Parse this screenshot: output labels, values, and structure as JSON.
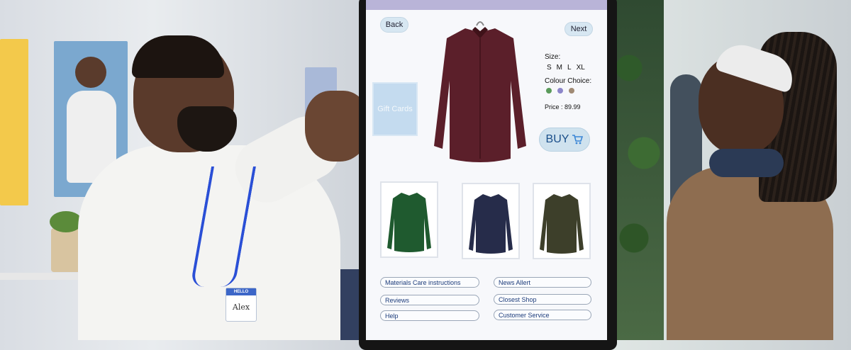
{
  "kiosk": {
    "nav": {
      "back_label": "Back",
      "next_label": "Next"
    },
    "gift_cards_label": "Gift Cards",
    "product": {
      "size_label": "Size:",
      "sizes": [
        "S",
        "M",
        "L",
        "XL"
      ],
      "colour_label": "Colour Choice:",
      "colours": [
        "#5a9a5a",
        "#8c86c9",
        "#a08a74"
      ],
      "price_text": "Price : 89.99",
      "buy_label": "BUY",
      "main_shirt_color": "#5b1f2a",
      "alt_shirts": [
        "#1f5a2f",
        "#262c4a",
        "#3d3f2a"
      ]
    },
    "links": [
      {
        "label": "Materials  Care instructions"
      },
      {
        "label": "News  Allert"
      },
      {
        "label": "Reviews"
      },
      {
        "label": "Closest Shop"
      },
      {
        "label": "Help"
      },
      {
        "label": "Customer Service"
      }
    ]
  },
  "badge": {
    "hello": "HELLO",
    "name": "Alex"
  }
}
